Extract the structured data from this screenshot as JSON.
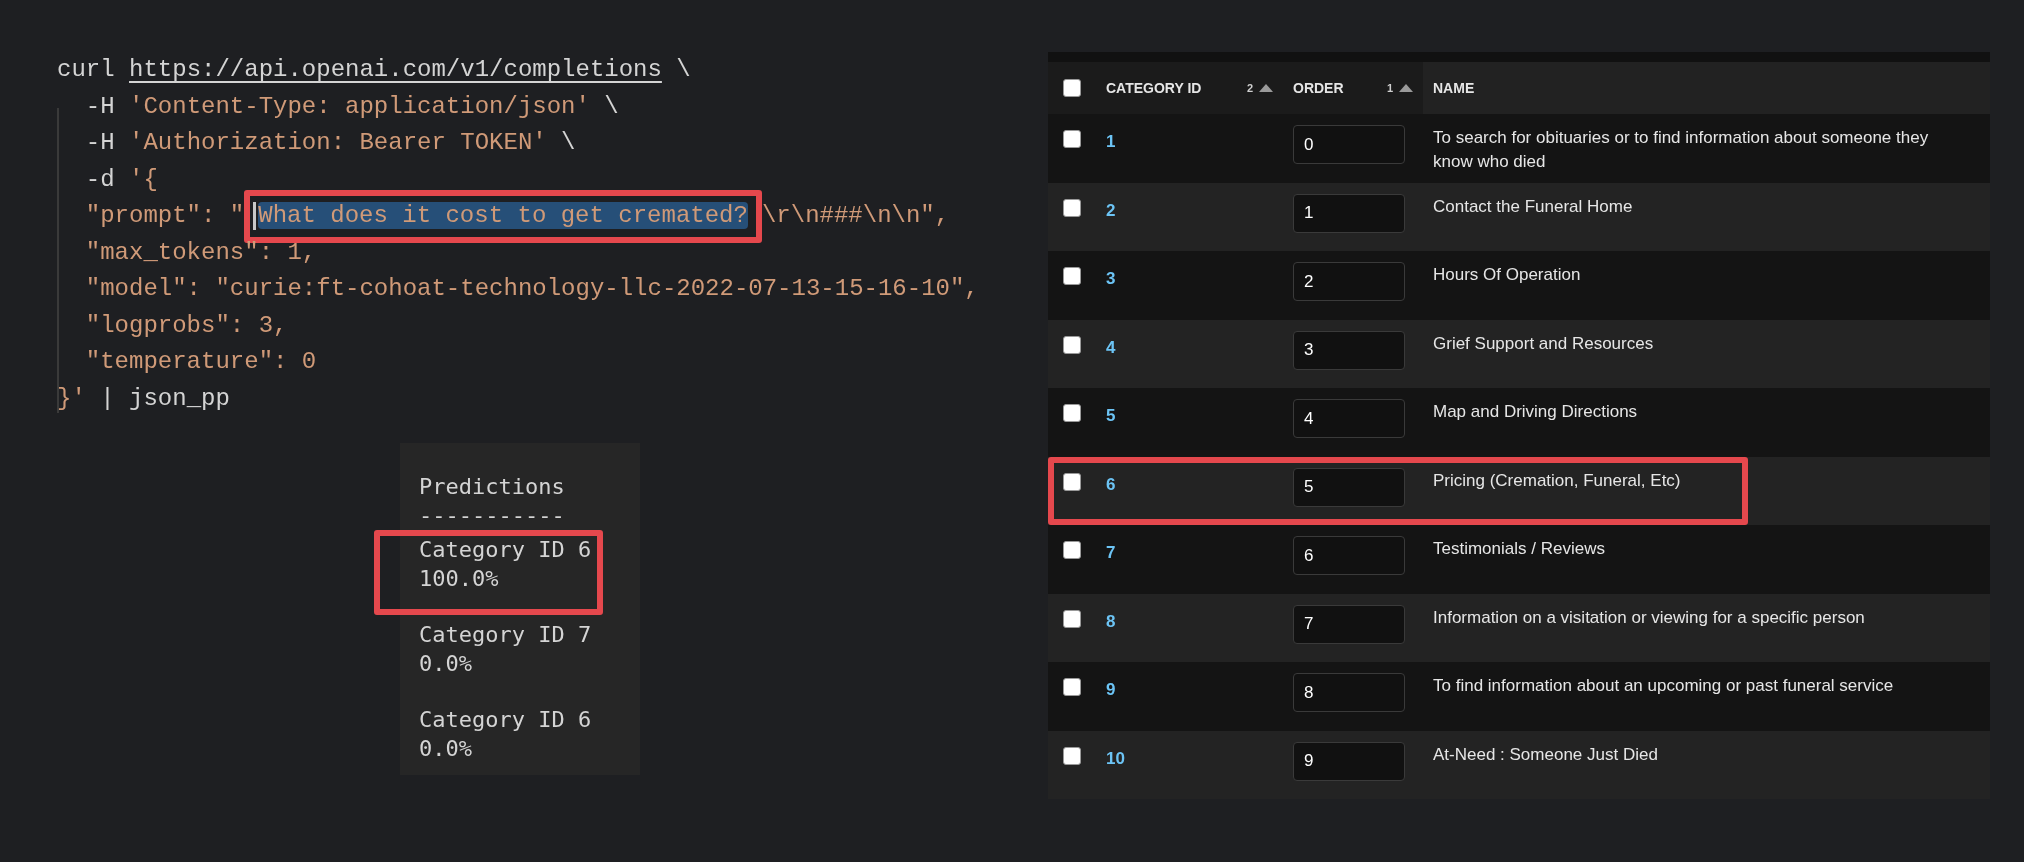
{
  "code": {
    "lines": [
      {
        "segments": [
          {
            "text": "curl ",
            "kind": "plain"
          },
          {
            "text": "https://api.openai.com/v1/completions",
            "kind": "link"
          },
          {
            "text": " \\",
            "kind": "plain"
          }
        ]
      },
      {
        "segments": [
          {
            "text": "  -H ",
            "kind": "plain"
          },
          {
            "text": "'Content-Type: application/json'",
            "kind": "string"
          },
          {
            "text": " \\",
            "kind": "plain"
          }
        ]
      },
      {
        "segments": [
          {
            "text": "  -H ",
            "kind": "plain"
          },
          {
            "text": "'Authorization: Bearer TOKEN'",
            "kind": "string"
          },
          {
            "text": " \\",
            "kind": "plain"
          }
        ]
      },
      {
        "segments": [
          {
            "text": "  -d ",
            "kind": "plain"
          },
          {
            "text": "'{",
            "kind": "string"
          }
        ]
      },
      {
        "segments": [
          {
            "text": "  \"prompt\": \"",
            "kind": "string"
          },
          {
            "text": "What does it cost to get cremated?",
            "kind": "selected",
            "highlighted": true
          },
          {
            "text": "\\r\\n###\\n\\n\",",
            "kind": "string"
          }
        ]
      },
      {
        "segments": [
          {
            "text": "  \"max_tokens\": 1,",
            "kind": "string"
          }
        ]
      },
      {
        "segments": [
          {
            "text": "  \"model\": \"curie:ft-cohoat-technology-llc-2022-07-13-15-16-10\",",
            "kind": "string"
          }
        ]
      },
      {
        "segments": [
          {
            "text": "  \"logprobs\": 3,",
            "kind": "string"
          }
        ]
      },
      {
        "segments": [
          {
            "text": "  \"temperature\": 0",
            "kind": "string"
          }
        ]
      },
      {
        "segments": [
          {
            "text": "}'",
            "kind": "string"
          },
          {
            "text": " | json_pp",
            "kind": "plain"
          }
        ]
      }
    ]
  },
  "predictions": {
    "title": "Predictions",
    "rule": "-----------",
    "items": [
      {
        "label": "Category ID 6",
        "value": "100.0%",
        "highlighted": true
      },
      {
        "label": "Category ID 7",
        "value": "0.0%",
        "highlighted": false
      },
      {
        "label": "Category ID 6",
        "value": "0.0%",
        "highlighted": false
      }
    ]
  },
  "table": {
    "select_all_checked": false,
    "columns": [
      {
        "label": "CATEGORY ID",
        "sort_rank": "2",
        "sort_ascending": true
      },
      {
        "label": "ORDER",
        "sort_rank": "1",
        "sort_ascending": true
      },
      {
        "label": "NAME"
      }
    ],
    "rows": [
      {
        "id": "1",
        "order": "0",
        "name": "To search for obituaries or to find information about someone they know who died",
        "checked": false,
        "highlighted": false
      },
      {
        "id": "2",
        "order": "1",
        "name": "Contact the Funeral Home",
        "checked": false,
        "highlighted": false
      },
      {
        "id": "3",
        "order": "2",
        "name": "Hours Of Operation",
        "checked": false,
        "highlighted": false
      },
      {
        "id": "4",
        "order": "3",
        "name": "Grief Support and Resources",
        "checked": false,
        "highlighted": false
      },
      {
        "id": "5",
        "order": "4",
        "name": "Map and Driving Directions",
        "checked": false,
        "highlighted": false
      },
      {
        "id": "6",
        "order": "5",
        "name": "Pricing (Cremation, Funeral, Etc)",
        "checked": false,
        "highlighted": true
      },
      {
        "id": "7",
        "order": "6",
        "name": "Testimonials / Reviews",
        "checked": false,
        "highlighted": false
      },
      {
        "id": "8",
        "order": "7",
        "name": "Information on a visitation or viewing for a specific person",
        "checked": false,
        "highlighted": false
      },
      {
        "id": "9",
        "order": "8",
        "name": "To find information about an upcoming or past funeral service",
        "checked": false,
        "highlighted": false
      },
      {
        "id": "10",
        "order": "9",
        "name": "At-Need : Someone Just Died",
        "checked": false,
        "highlighted": false
      }
    ]
  }
}
